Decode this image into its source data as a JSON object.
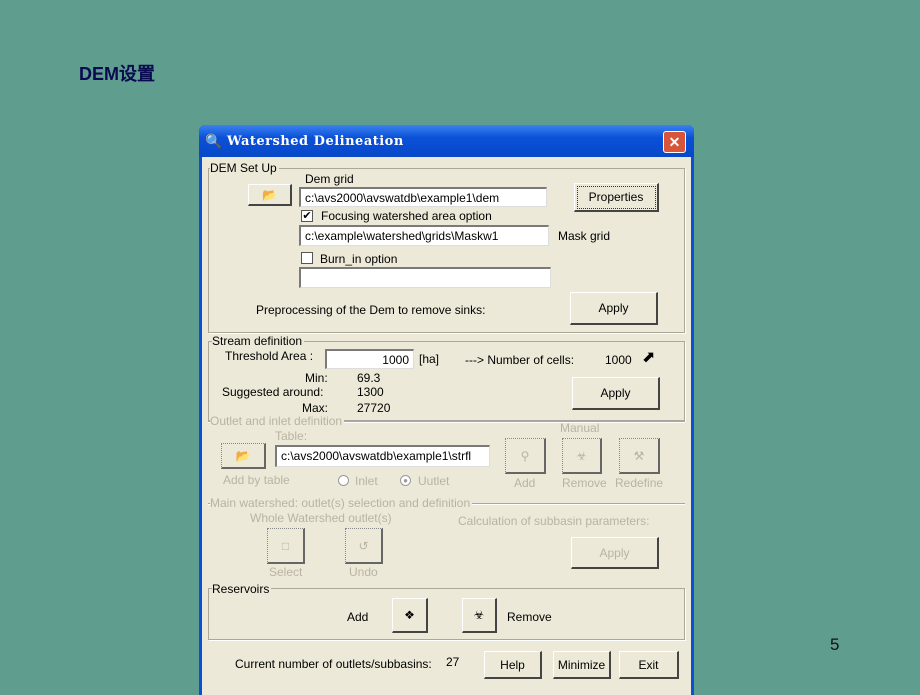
{
  "slide": {
    "title": "DEM设置",
    "page_number": "5"
  },
  "window": {
    "title": "Watershed Delineation",
    "close": "✕",
    "app_icon": "magnifier-globe-icon"
  },
  "dem": {
    "legend": "DEM Set Up",
    "dem_grid_label": "Dem grid",
    "dem_grid_value": "c:\\avs2000\\avswatdb\\example1\\dem",
    "properties": "Properties",
    "focus_checked": true,
    "focus_label": "Focusing watershed  area option",
    "mask_value": "c:\\example\\watershed\\grids\\Maskw1",
    "mask_label": "Mask grid",
    "burn_checked": false,
    "burn_label": "Burn_in option",
    "burn_value": "",
    "preprocess_label": "Preprocessing of the Dem to remove sinks:",
    "apply": "Apply"
  },
  "stream": {
    "legend": "Stream definition",
    "threshold_label": "Threshold Area :",
    "threshold_value": "1000",
    "unit": "[ha]",
    "cells_label": "---> Number of cells:",
    "cells_value": "1000",
    "min_label": "Min:",
    "min_value": "69.3",
    "suggested_label": "Suggested around:",
    "suggested_value": "1300",
    "max_label": "Max:",
    "max_value": "27720",
    "apply": "Apply"
  },
  "outlet": {
    "legend": "Outlet  and inlet definition",
    "table_label": "Table:",
    "table_value": "c:\\avs2000\\avswatdb\\example1\\strfl",
    "add_by_table": "Add by table",
    "inlet": "Inlet",
    "outlet": "Uutlet",
    "selected": "outlet",
    "manual": "Manual",
    "add": "Add",
    "remove": "Remove",
    "redefine": "Redefine"
  },
  "main": {
    "legend": "Main watershed: outlet(s) selection and definition",
    "whole": "Whole Watershed outlet(s)",
    "select": "Select",
    "undo": "Undo",
    "calc_label": "Calculation of subbasin parameters:",
    "apply": "Apply"
  },
  "reservoirs": {
    "legend": "Reservoirs",
    "add": "Add",
    "remove": "Remove"
  },
  "footer": {
    "count_label": "Current number of outlets/subbasins:",
    "count_value": "27",
    "help": "Help",
    "minimize": "Minimize",
    "exit": "Exit"
  }
}
